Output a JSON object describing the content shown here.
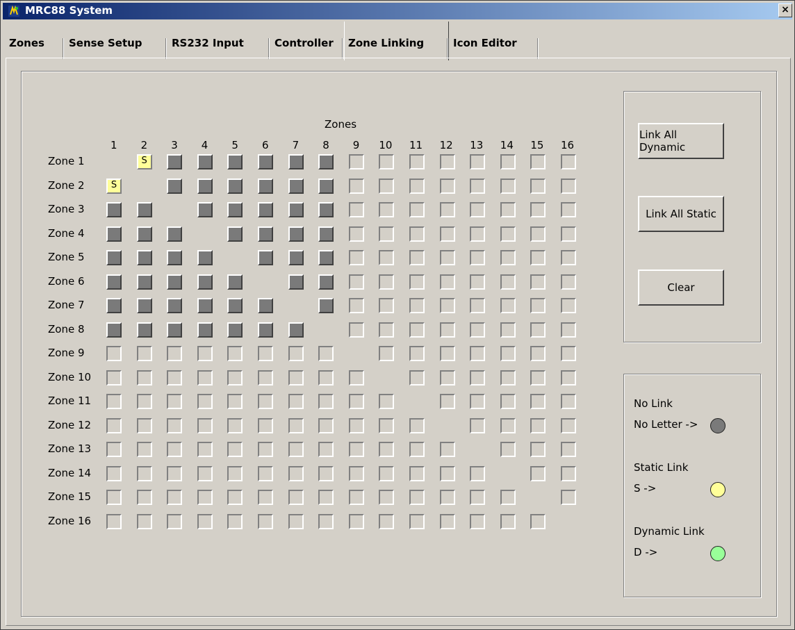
{
  "window": {
    "title": "MRC88 System",
    "close_glyph": "×",
    "icon": "app-icon"
  },
  "tabs": [
    {
      "label": "Zones"
    },
    {
      "label": "Sense Setup"
    },
    {
      "label": "RS232 Input"
    },
    {
      "label": "Controller"
    },
    {
      "label": "Zone Linking",
      "active": true
    },
    {
      "label": "Icon Editor"
    }
  ],
  "matrix": {
    "header": "Zones",
    "columns": [
      "1",
      "2",
      "3",
      "4",
      "5",
      "6",
      "7",
      "8",
      "9",
      "10",
      "11",
      "12",
      "13",
      "14",
      "15",
      "16"
    ],
    "rows": [
      "Zone 1",
      "Zone 2",
      "Zone 3",
      "Zone 4",
      "Zone 5",
      "Zone 6",
      "Zone 7",
      "Zone 8",
      "Zone 9",
      "Zone 10",
      "Zone 11",
      "Zone 12",
      "Zone 13",
      "Zone 14",
      "Zone 15",
      "Zone 16"
    ],
    "links": [
      "-SNNNNNNEEEEEEEE",
      "S-NNNNNNEEEEEEEE",
      "NN-NNNNNEEEEEEEE",
      "NNN-NNNNEEEEEEEE",
      "NNNN-NNNEEEEEEEE",
      "NNNNN-NNEEEEEEEE",
      "NNNNNN-NEEEEEEEE",
      "NNNNNNN-EEEEEEEE",
      "EEEEEEEE-EEEEEEE",
      "EEEEEEEEE-EEEEEE",
      "EEEEEEEEEE-EEEEE",
      "EEEEEEEEEEE-EEEE",
      "EEEEEEEEEEEE-EEE",
      "EEEEEEEEEEEEE-EE",
      "EEEEEEEEEEEEEE-E",
      "EEEEEEEEEEEEEEE-"
    ],
    "static_letter": "S"
  },
  "buttons": {
    "link_all_dynamic": "Link All Dynamic",
    "link_all_static": "Link All Static",
    "clear": "Clear"
  },
  "legend": {
    "no_link_title": "No Link",
    "no_link_key": "No Letter ->",
    "no_link_color": "#7a7a7a",
    "static_title": "Static Link",
    "static_key": "S ->",
    "static_color": "#ffff99",
    "dynamic_title": "Dynamic Link",
    "dynamic_key": "D ->",
    "dynamic_color": "#99ff99"
  }
}
